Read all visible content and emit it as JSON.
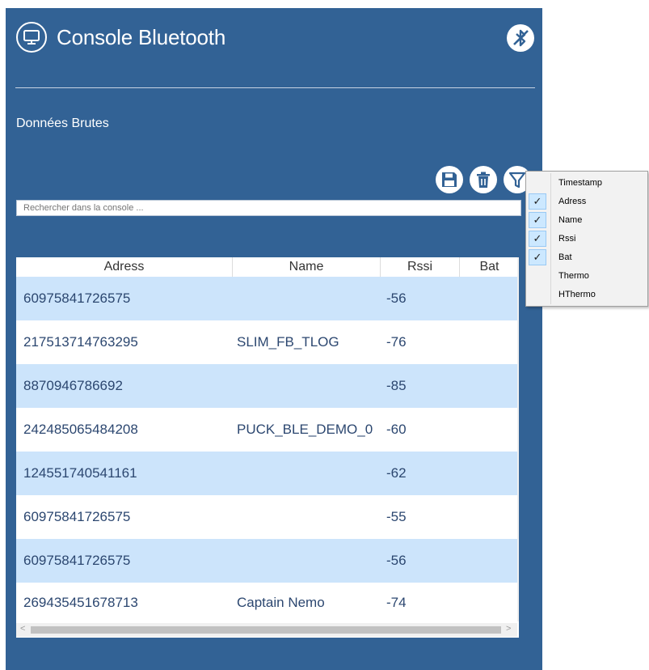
{
  "app": {
    "title": "Console Bluetooth",
    "section_label": "Données Brutes"
  },
  "search": {
    "placeholder": "Rechercher dans la console ..."
  },
  "table": {
    "columns": [
      "Adress",
      "Name",
      "Rssi",
      "Bat"
    ],
    "rows": [
      {
        "adress": "60975841726575",
        "name": "",
        "rssi": "-56"
      },
      {
        "adress": "217513714763295",
        "name": "SLIM_FB_TLOG",
        "rssi": "-76"
      },
      {
        "adress": "8870946786692",
        "name": "",
        "rssi": "-85"
      },
      {
        "adress": "242485065484208",
        "name": "PUCK_BLE_DEMO_0",
        "rssi": "-60"
      },
      {
        "adress": "124551740541161",
        "name": "",
        "rssi": "-62"
      },
      {
        "adress": "60975841726575",
        "name": "",
        "rssi": "-55"
      },
      {
        "adress": "60975841726575",
        "name": "",
        "rssi": "-56"
      },
      {
        "adress": "269435451678713",
        "name": "Captain Nemo",
        "rssi": "-74"
      }
    ]
  },
  "column_menu": {
    "items": [
      {
        "label": "Timestamp",
        "checked": false
      },
      {
        "label": "Adress",
        "checked": true
      },
      {
        "label": "Name",
        "checked": true
      },
      {
        "label": "Rssi",
        "checked": true
      },
      {
        "label": "Bat",
        "checked": true
      },
      {
        "label": "Thermo",
        "checked": false
      },
      {
        "label": "HThermo",
        "checked": false
      }
    ]
  },
  "icons": {
    "app": "monitor-icon",
    "bluetooth_off": "bluetooth-disabled-icon",
    "save": "save-icon",
    "delete": "trash-icon",
    "filter": "filter-icon"
  },
  "colors": {
    "panel_bg": "#326295",
    "row_alt": "#cce4fb",
    "cell_text": "#2c4770"
  }
}
